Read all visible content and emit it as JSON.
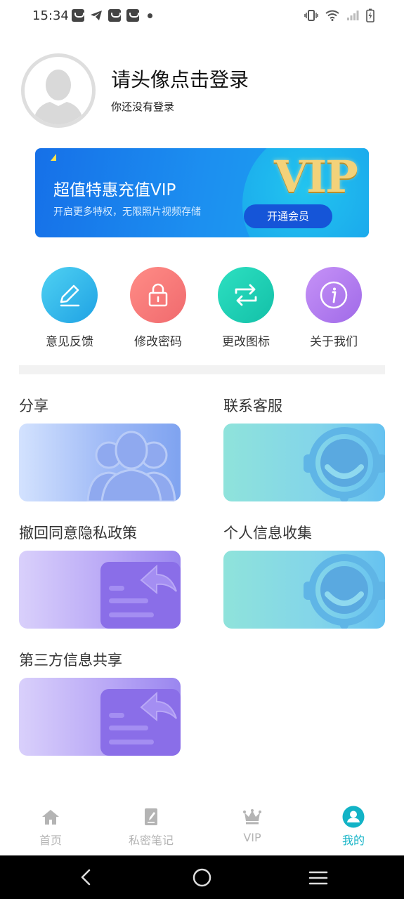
{
  "status_bar": {
    "time": "15:34"
  },
  "profile": {
    "title": "请头像点击登录",
    "subtitle": "你还没有登录"
  },
  "vip_banner": {
    "title": "超值特惠充值VIP",
    "subtitle": "开启更多特权，无限照片视频存储",
    "badge_text": "VIP",
    "button_label": "开通会员"
  },
  "quick_actions": [
    {
      "label": "意见反馈",
      "icon": "pencil-icon",
      "color": "#30b7e8"
    },
    {
      "label": "修改密码",
      "icon": "lock-icon",
      "color": "#f67a74"
    },
    {
      "label": "更改图标",
      "icon": "swap-icon",
      "color": "#1fcdb0"
    },
    {
      "label": "关于我们",
      "icon": "info-icon",
      "color": "#b07cef"
    }
  ],
  "cards": [
    {
      "title": "分享",
      "icon": "users-icon"
    },
    {
      "title": "联系客服",
      "icon": "headset-icon"
    },
    {
      "title": "撤回同意隐私政策",
      "icon": "reply-doc-icon"
    },
    {
      "title": "个人信息收集",
      "icon": "headset-icon"
    },
    {
      "title": "第三方信息共享",
      "icon": "reply-doc-icon"
    }
  ],
  "bottom_nav": [
    {
      "label": "首页",
      "icon": "home-icon",
      "active": false
    },
    {
      "label": "私密笔记",
      "icon": "note-icon",
      "active": false
    },
    {
      "label": "VIP",
      "icon": "crown-icon",
      "active": false
    },
    {
      "label": "我的",
      "icon": "person-icon",
      "active": true
    }
  ],
  "colors": {
    "accent": "#12b3c6",
    "vip_blue": "#1670e8",
    "inactive_nav": "#b4b4b4"
  }
}
